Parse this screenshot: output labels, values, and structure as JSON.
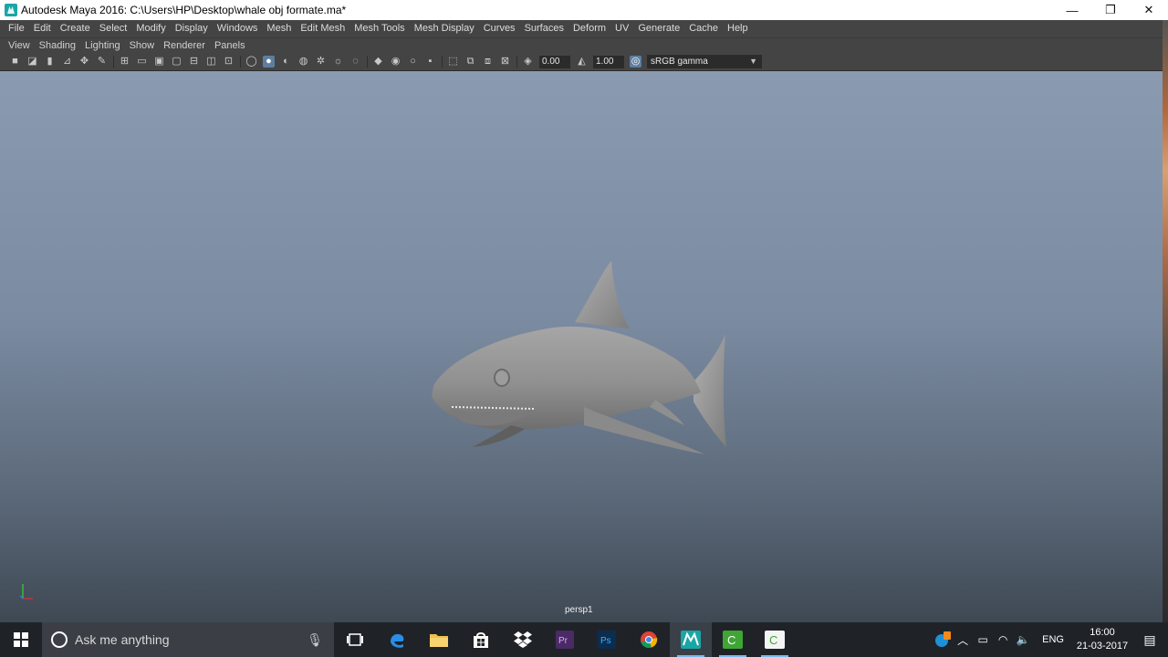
{
  "window": {
    "title": "Autodesk Maya 2016: C:\\Users\\HP\\Desktop\\whale obj formate.ma*",
    "controls": {
      "minimize": "—",
      "restore": "❐",
      "close": "✕"
    }
  },
  "menubar": {
    "items": [
      "File",
      "Edit",
      "Create",
      "Select",
      "Modify",
      "Display",
      "Windows",
      "Mesh",
      "Edit Mesh",
      "Mesh Tools",
      "Mesh Display",
      "Curves",
      "Surfaces",
      "Deform",
      "UV",
      "Generate",
      "Cache",
      "Help"
    ]
  },
  "panel_menu": {
    "items": [
      "View",
      "Shading",
      "Lighting",
      "Show",
      "Renderer",
      "Panels"
    ]
  },
  "toolbar": {
    "exposure_value": "0.00",
    "gamma_value": "1.00",
    "color_space": "sRGB gamma"
  },
  "viewport": {
    "camera_label": "persp1",
    "background_top": "#8a9bb1",
    "background_bottom": "#3f4954",
    "model_color": "#9a9a9a"
  },
  "taskbar": {
    "search_placeholder": "Ask me anything",
    "language": "ENG",
    "time": "16:00",
    "date": "21-03-2017"
  }
}
